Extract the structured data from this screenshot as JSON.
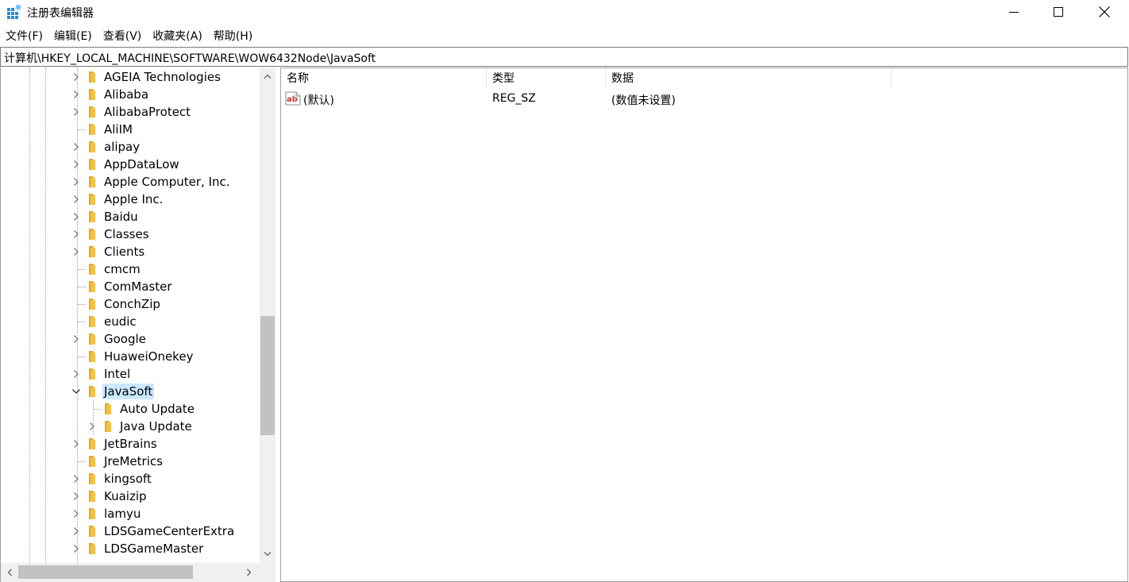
{
  "window": {
    "title": "注册表编辑器",
    "icon": "registry-editor-icon"
  },
  "menu": [
    "文件(F)",
    "编辑(E)",
    "查看(V)",
    "收藏夹(A)",
    "帮助(H)"
  ],
  "address": "计算机\\HKEY_LOCAL_MACHINE\\SOFTWARE\\WOW6432Node\\JavaSoft",
  "tree": {
    "items": [
      {
        "label": "AGEIA Technologies",
        "level": 0,
        "expander": "collapsed"
      },
      {
        "label": "Alibaba",
        "level": 0,
        "expander": "collapsed"
      },
      {
        "label": "AlibabaProtect",
        "level": 0,
        "expander": "collapsed"
      },
      {
        "label": "AliIM",
        "level": 0,
        "expander": "none"
      },
      {
        "label": "alipay",
        "level": 0,
        "expander": "collapsed"
      },
      {
        "label": "AppDataLow",
        "level": 0,
        "expander": "collapsed"
      },
      {
        "label": "Apple Computer, Inc.",
        "level": 0,
        "expander": "collapsed"
      },
      {
        "label": "Apple Inc.",
        "level": 0,
        "expander": "collapsed"
      },
      {
        "label": "Baidu",
        "level": 0,
        "expander": "collapsed"
      },
      {
        "label": "Classes",
        "level": 0,
        "expander": "collapsed"
      },
      {
        "label": "Clients",
        "level": 0,
        "expander": "collapsed"
      },
      {
        "label": "cmcm",
        "level": 0,
        "expander": "none"
      },
      {
        "label": "ComMaster",
        "level": 0,
        "expander": "none"
      },
      {
        "label": "ConchZip",
        "level": 0,
        "expander": "none"
      },
      {
        "label": "eudic",
        "level": 0,
        "expander": "none"
      },
      {
        "label": "Google",
        "level": 0,
        "expander": "collapsed"
      },
      {
        "label": "HuaweiOnekey",
        "level": 0,
        "expander": "none"
      },
      {
        "label": "Intel",
        "level": 0,
        "expander": "collapsed"
      },
      {
        "label": "JavaSoft",
        "level": 0,
        "expander": "expanded",
        "selected": true
      },
      {
        "label": "Auto Update",
        "level": 1,
        "expander": "none"
      },
      {
        "label": "Java Update",
        "level": 1,
        "expander": "collapsed"
      },
      {
        "label": "JetBrains",
        "level": 0,
        "expander": "collapsed"
      },
      {
        "label": "JreMetrics",
        "level": 0,
        "expander": "none"
      },
      {
        "label": "kingsoft",
        "level": 0,
        "expander": "collapsed"
      },
      {
        "label": "Kuaizip",
        "level": 0,
        "expander": "collapsed"
      },
      {
        "label": "lamyu",
        "level": 0,
        "expander": "collapsed"
      },
      {
        "label": "LDSGameCenterExtra",
        "level": 0,
        "expander": "collapsed"
      },
      {
        "label": "LDSGameMaster",
        "level": 0,
        "expander": "collapsed"
      }
    ]
  },
  "list": {
    "columns": [
      "名称",
      "类型",
      "数据"
    ],
    "rows": [
      {
        "name": "(默认)",
        "type": "REG_SZ",
        "data": "(数值未设置)",
        "icon": "string-value-icon"
      }
    ]
  },
  "colors": {
    "selection": "#cce8ff",
    "folder": "#f5c242",
    "folder_dark": "#dcaa2c",
    "scroll_thumb": "#c2c2c2",
    "scroll_track": "#f0f0f0"
  }
}
